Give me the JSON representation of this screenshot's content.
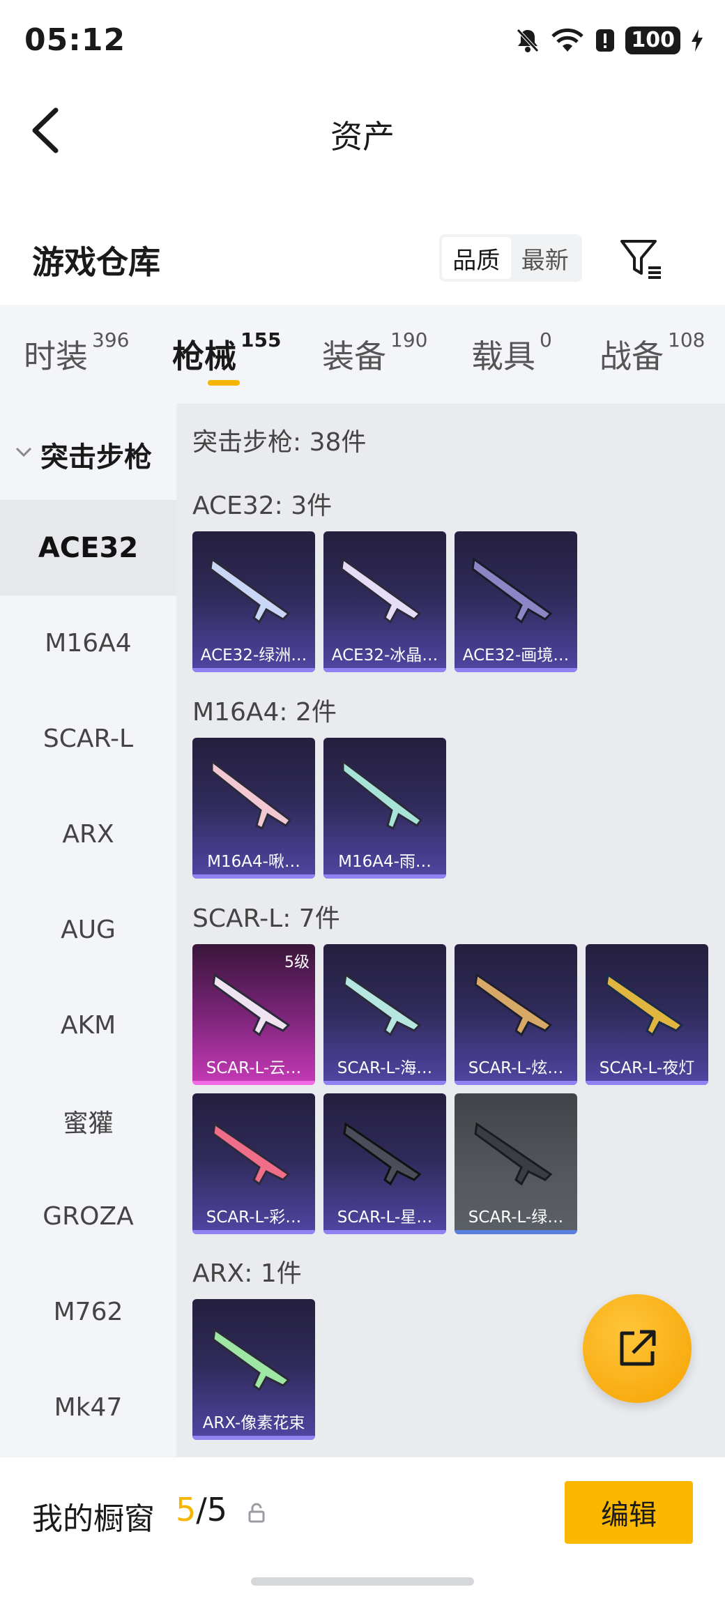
{
  "status_bar": {
    "time": "05:12",
    "battery": "100"
  },
  "nav": {
    "title": "资产"
  },
  "section": {
    "title": "游戏仓库",
    "sort_options": [
      "品质",
      "最新"
    ],
    "sort_selected": "品质"
  },
  "tabs": [
    {
      "label": "时装",
      "count": "396"
    },
    {
      "label": "枪械",
      "count": "155"
    },
    {
      "label": "装备",
      "count": "190"
    },
    {
      "label": "载具",
      "count": "0"
    },
    {
      "label": "战备",
      "count": "108"
    }
  ],
  "sidebar": {
    "group": "突击步枪",
    "items": [
      "ACE32",
      "M16A4",
      "SCAR-L",
      "ARX",
      "AUG",
      "AKM",
      "蜜獾",
      "GROZA",
      "M762",
      "Mk47"
    ],
    "selected": "ACE32"
  },
  "content": {
    "summary": "突击步枪: 38件",
    "groups": [
      {
        "title": "ACE32: 3件",
        "items": [
          "ACE32-绿洲…",
          "ACE32-冰晶…",
          "ACE32-画境…"
        ]
      },
      {
        "title": "M16A4: 2件",
        "items": [
          "M16A4-啾…",
          "M16A4-雨…"
        ]
      },
      {
        "title": "SCAR-L: 7件",
        "items": [
          "SCAR-L-云…",
          "SCAR-L-海…",
          "SCAR-L-炫…",
          "SCAR-L-夜灯",
          "SCAR-L-彩…",
          "SCAR-L-星…",
          "SCAR-L-绿…"
        ],
        "badge": "5级"
      },
      {
        "title": "ARX: 1件",
        "items": [
          "ARX-像素花束"
        ]
      }
    ]
  },
  "bottom": {
    "title": "我的橱窗",
    "count_current": "5",
    "count_sep": "/",
    "count_total": "5",
    "edit_label": "编辑"
  },
  "colors": {
    "accent": "#fbb800",
    "card_purple": "#5046a4",
    "card_pink": "#c63ab7"
  }
}
